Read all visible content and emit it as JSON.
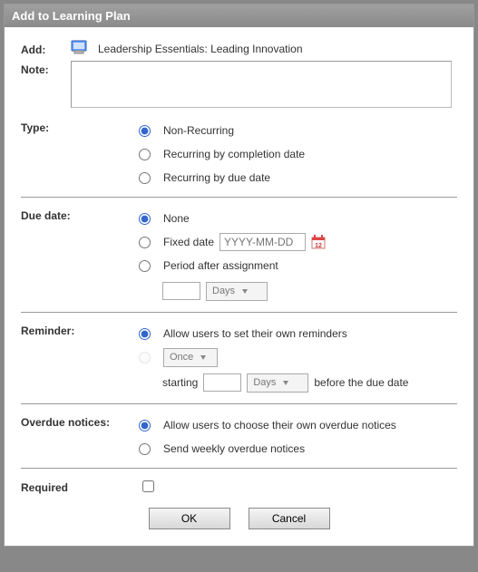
{
  "dialog": {
    "title": "Add to Learning Plan"
  },
  "labels": {
    "add": "Add:",
    "note": "Note:",
    "type": "Type:",
    "dueDate": "Due date:",
    "reminder": "Reminder:",
    "overdue": "Overdue notices:",
    "required": "Required"
  },
  "course": {
    "title": "Leadership Essentials: Leading Innovation"
  },
  "type": {
    "selected": "non-recurring",
    "options": {
      "nonRecurring": "Non-Recurring",
      "byCompletion": "Recurring by completion date",
      "byDue": "Recurring by due date"
    }
  },
  "dueDate": {
    "selected": "none",
    "options": {
      "none": "None",
      "fixed": "Fixed date",
      "period": "Period after assignment"
    },
    "fixedPlaceholder": "YYYY-MM-DD",
    "periodValue": "",
    "periodUnit": "Days"
  },
  "reminder": {
    "selected": "user",
    "options": {
      "user": "Allow users to set their own reminders"
    },
    "freq": "Once",
    "startingLabel": "starting",
    "startValue": "",
    "startUnit": "Days",
    "beforeLabel": "before the due date"
  },
  "overdue": {
    "selected": "user",
    "options": {
      "user": "Allow users to choose their own overdue notices",
      "weekly": "Send weekly overdue notices"
    }
  },
  "required": {
    "checked": false
  },
  "buttons": {
    "ok": "OK",
    "cancel": "Cancel"
  }
}
